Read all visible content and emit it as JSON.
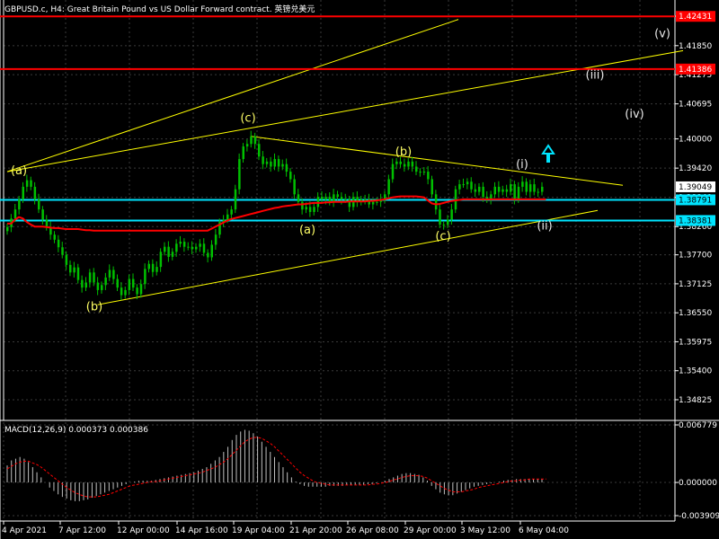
{
  "header": {
    "title": "GBPUSD.c, H4:  Great Britain Pound vs US Dollar Forward contract. 英镑兑美元",
    "macd_label": "MACD(12,26,9) 0.000373 0.000386"
  },
  "colors": {
    "background": "#000000",
    "grid": "#3a3a3a",
    "candle": "#00c000",
    "ma": "#ff0000",
    "trend": "#ffff00",
    "resistance": "#ff0000",
    "support": "#00e5ff",
    "macd_hist": "#c0c0c0",
    "macd_signal": "#ff0000",
    "wave_yellow": "#ffff66",
    "wave_white": "#e8e8e8",
    "arrow": "#00e5ff"
  },
  "chart_data": {
    "type": "candlestick",
    "price_axis_ticks": [
      "1.42435",
      "1.41850",
      "1.41275",
      "1.40695",
      "1.40000",
      "1.39420",
      "1.38840",
      "1.38260",
      "1.37700",
      "1.37125",
      "1.36550",
      "1.35975",
      "1.35400",
      "1.34825"
    ],
    "price_ylim": [
      1.3445,
      1.4272
    ],
    "time_axis_ticks": [
      "4 Apr 2021",
      "7 Apr 12:00",
      "12 Apr 00:00",
      "14 Apr 16:00",
      "19 Apr 04:00",
      "21 Apr 20:00",
      "26 Apr 08:00",
      "29 Apr 00:00",
      "3 May 12:00",
      "6 May 04:00"
    ],
    "price_tags": {
      "resistance_top": "1.42431",
      "resistance_2": "1.41386",
      "current": "1.39049",
      "support_1": "1.38791",
      "support_2": "1.38381"
    },
    "horizontal_levels": [
      {
        "label": "1.42431",
        "value": 1.42431,
        "kind": "resistance"
      },
      {
        "label": "1.41386",
        "value": 1.41386,
        "kind": "resistance"
      },
      {
        "label": "1.38791",
        "value": 1.38791,
        "kind": "support"
      },
      {
        "label": "1.38381",
        "value": 1.38381,
        "kind": "support"
      }
    ],
    "close_series": [
      1.3825,
      1.3842,
      1.386,
      1.388,
      1.3905,
      1.3918,
      1.3905,
      1.388,
      1.386,
      1.384,
      1.3825,
      1.381,
      1.38,
      1.3785,
      1.377,
      1.375,
      1.3735,
      1.3745,
      1.372,
      1.3705,
      1.3715,
      1.3735,
      1.3715,
      1.37,
      1.371,
      1.3725,
      1.374,
      1.3722,
      1.3705,
      1.369,
      1.37,
      1.3722,
      1.3705,
      1.3692,
      1.3712,
      1.3742,
      1.3752,
      1.3736,
      1.3746,
      1.3776,
      1.3786,
      1.3766,
      1.3776,
      1.3792,
      1.3796,
      1.3786,
      1.3786,
      1.3781,
      1.3786,
      1.3792,
      1.3774,
      1.3765,
      1.379,
      1.381,
      1.3835,
      1.384,
      1.385,
      1.386,
      1.39,
      1.396,
      1.3985,
      1.399,
      1.4005,
      1.399,
      1.3965,
      1.395,
      1.3955,
      1.3945,
      1.396,
      1.3945,
      1.395,
      1.3935,
      1.392,
      1.389,
      1.3875,
      1.386,
      1.3865,
      1.3855,
      1.3865,
      1.3885,
      1.388,
      1.3885,
      1.3875,
      1.389,
      1.3885,
      1.388,
      1.388,
      1.3865,
      1.3885,
      1.3875,
      1.388,
      1.388,
      1.387,
      1.3875,
      1.3875,
      1.388,
      1.389,
      1.392,
      1.395,
      1.3955,
      1.395,
      1.3945,
      1.3955,
      1.3945,
      1.3935,
      1.3935,
      1.3935,
      1.392,
      1.389,
      1.386,
      1.383,
      1.383,
      1.384,
      1.386,
      1.39,
      1.391,
      1.391,
      1.3915,
      1.39,
      1.3895,
      1.3905,
      1.3885,
      1.388,
      1.389,
      1.3905,
      1.3895,
      1.39,
      1.3895,
      1.391,
      1.388,
      1.3905,
      1.3915,
      1.3895,
      1.391,
      1.3895,
      1.3895,
      1.3905
    ],
    "ma_series": [
      1.3832,
      1.3832,
      1.384,
      1.3845,
      1.3842,
      1.3835,
      1.383,
      1.3826,
      1.3826,
      1.3826,
      1.3825,
      1.3824,
      1.3823,
      1.3823,
      1.3822,
      1.3821,
      1.3821,
      1.3821,
      1.3821,
      1.382,
      1.3819,
      1.3819,
      1.3818,
      1.3818,
      1.3818,
      1.3818,
      1.3818,
      1.3818,
      1.3818,
      1.3818,
      1.3818,
      1.3818,
      1.3818,
      1.3818,
      1.3818,
      1.3818,
      1.3818,
      1.3818,
      1.3818,
      1.3818,
      1.3818,
      1.3818,
      1.3818,
      1.3818,
      1.3818,
      1.3818,
      1.3818,
      1.3818,
      1.3818,
      1.3818,
      1.3818,
      1.3818,
      1.3822,
      1.3826,
      1.383,
      1.3834,
      1.3838,
      1.3841,
      1.3843,
      1.3845,
      1.3847,
      1.3849,
      1.3851,
      1.3853,
      1.3855,
      1.3857,
      1.3859,
      1.3861,
      1.3863,
      1.3864,
      1.3866,
      1.3867,
      1.3868,
      1.3869,
      1.387,
      1.387,
      1.3871,
      1.3872,
      1.3873,
      1.3873,
      1.3873,
      1.3874,
      1.3874,
      1.3875,
      1.3875,
      1.3875,
      1.3875,
      1.3876,
      1.3876,
      1.3876,
      1.3876,
      1.3876,
      1.3877,
      1.3877,
      1.3878,
      1.3879,
      1.388,
      1.3882,
      1.3884,
      1.3885,
      1.3886,
      1.3886,
      1.3886,
      1.3886,
      1.3886,
      1.3885,
      1.3884,
      1.3878,
      1.3872,
      1.387,
      1.3871,
      1.3873,
      1.3875,
      1.3877,
      1.3878,
      1.3879,
      1.388,
      1.388,
      1.388,
      1.388,
      1.388,
      1.388,
      1.388,
      1.388,
      1.388,
      1.388,
      1.388,
      1.388,
      1.388,
      1.388,
      1.388,
      1.388,
      1.388,
      1.388,
      1.388,
      1.388,
      1.388,
      1.388
    ],
    "wave_labels": [
      {
        "text": "(a)",
        "color": "yellow"
      },
      {
        "text": "(b)",
        "color": "yellow"
      },
      {
        "text": "(c)",
        "color": "yellow"
      },
      {
        "text": "(a)",
        "color": "yellow"
      },
      {
        "text": "(b)",
        "color": "yellow"
      },
      {
        "text": "(c)",
        "color": "yellow"
      },
      {
        "text": "(i)",
        "color": "white"
      },
      {
        "text": "(ii)",
        "color": "white"
      },
      {
        "text": "(iii)",
        "color": "white"
      },
      {
        "text": "(iv)",
        "color": "white"
      },
      {
        "text": "(v)",
        "color": "white"
      }
    ],
    "macd": {
      "ticks": [
        "0.006779",
        "0.000000",
        "-0.003909"
      ],
      "ylim": [
        -0.003909,
        0.006779
      ],
      "histogram": [
        0.002,
        0.0026,
        0.0028,
        0.003,
        0.0028,
        0.0024,
        0.0018,
        0.0012,
        0.0006,
        0.0,
        -0.0006,
        -0.001,
        -0.0014,
        -0.0017,
        -0.0019,
        -0.0021,
        -0.0022,
        -0.0022,
        -0.0021,
        -0.002,
        -0.0018,
        -0.0016,
        -0.0014,
        -0.0012,
        -0.001,
        -0.0008,
        -0.0006,
        -0.0004,
        -0.0002,
        0.0,
        0.0001,
        0.0002,
        0.0002,
        0.0002,
        0.0002,
        0.0003,
        0.0004,
        0.0005,
        0.0006,
        0.0007,
        0.0008,
        0.0009,
        0.001,
        0.0011,
        0.0012,
        0.0014,
        0.0016,
        0.0018,
        0.0022,
        0.0026,
        0.003,
        0.0036,
        0.0042,
        0.005,
        0.0056,
        0.006,
        0.0062,
        0.0061,
        0.0058,
        0.0054,
        0.0048,
        0.0042,
        0.0036,
        0.003,
        0.0024,
        0.0018,
        0.0012,
        0.0006,
        0.0001,
        -0.0002,
        -0.0004,
        -0.0005,
        -0.0005,
        -0.0005,
        -0.0005,
        -0.0005,
        -0.0004,
        -0.0004,
        -0.0004,
        -0.0004,
        -0.0003,
        -0.0003,
        -0.0003,
        -0.0003,
        -0.0003,
        -0.0002,
        -0.0002,
        -0.0001,
        0.0,
        0.0002,
        0.0004,
        0.0006,
        0.0008,
        0.001,
        0.0011,
        0.0011,
        0.001,
        0.0009,
        0.0006,
        0.0002,
        -0.0004,
        -0.0008,
        -0.0012,
        -0.0014,
        -0.0015,
        -0.0015,
        -0.0013,
        -0.0011,
        -0.0009,
        -0.0007,
        -0.0005,
        -0.0004,
        -0.0003,
        -0.0002,
        -0.0001,
        0.0,
        0.0001,
        0.0002,
        0.0003,
        0.0003,
        0.0004,
        0.0004,
        0.0004,
        0.0004,
        0.0004,
        0.0004,
        0.0004
      ],
      "signal": [
        0.0016,
        0.0019,
        0.0022,
        0.0024,
        0.0025,
        0.0025,
        0.0023,
        0.0021,
        0.0018,
        0.0014,
        0.001,
        0.0006,
        0.0002,
        -0.0002,
        -0.0006,
        -0.0009,
        -0.0012,
        -0.0014,
        -0.0016,
        -0.0017,
        -0.0017,
        -0.0017,
        -0.0016,
        -0.0015,
        -0.0014,
        -0.0012,
        -0.001,
        -0.0008,
        -0.0006,
        -0.0004,
        -0.0003,
        -0.0002,
        -0.0001,
        0.0,
        0.0001,
        0.0001,
        0.0002,
        0.0003,
        0.0004,
        0.0005,
        0.0006,
        0.0007,
        0.0008,
        0.0009,
        0.001,
        0.0011,
        0.0012,
        0.0014,
        0.0016,
        0.0018,
        0.0021,
        0.0024,
        0.0028,
        0.0033,
        0.0038,
        0.0043,
        0.0048,
        0.0051,
        0.0053,
        0.0053,
        0.0052,
        0.0049,
        0.0046,
        0.0042,
        0.0037,
        0.0032,
        0.0027,
        0.0022,
        0.0017,
        0.0012,
        0.0008,
        0.0005,
        0.0002,
        0.0,
        -0.0001,
        -0.0002,
        -0.0003,
        -0.0003,
        -0.0003,
        -0.0003,
        -0.0003,
        -0.0003,
        -0.0003,
        -0.0003,
        -0.0003,
        -0.0003,
        -0.0002,
        -0.0002,
        -0.0001,
        0.0,
        0.0001,
        0.0003,
        0.0004,
        0.0006,
        0.0007,
        0.0008,
        0.0008,
        0.0008,
        0.0007,
        0.0005,
        0.0002,
        -0.0001,
        -0.0004,
        -0.0007,
        -0.0009,
        -0.0011,
        -0.0011,
        -0.0011,
        -0.001,
        -0.0009,
        -0.0008,
        -0.0006,
        -0.0005,
        -0.0004,
        -0.0003,
        -0.0002,
        -0.0001,
        0.0,
        0.0001,
        0.0002,
        0.0002,
        0.0003,
        0.0003,
        0.0004,
        0.0004,
        0.0004,
        0.0004,
        0.0004
      ]
    }
  }
}
